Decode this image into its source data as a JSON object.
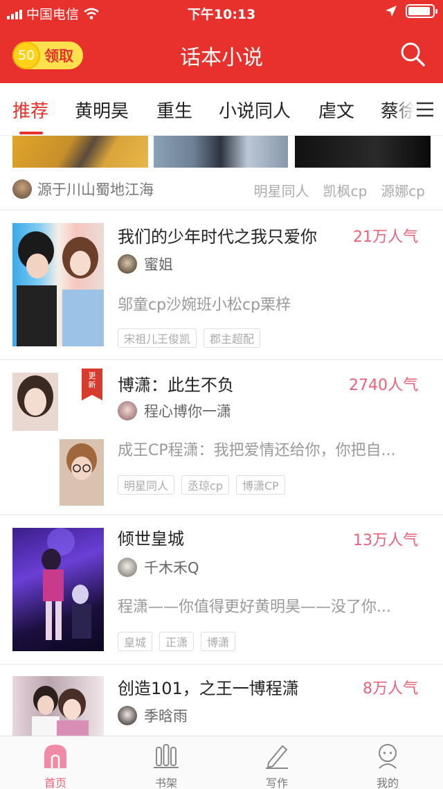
{
  "status_bar": {
    "carrier": "中国电信",
    "time": "下午10:13"
  },
  "header": {
    "claim_amount": "50",
    "claim_label": "领取",
    "title": "话本小说"
  },
  "tabs": [
    {
      "label": "推荐",
      "active": true
    },
    {
      "label": "黄明昊"
    },
    {
      "label": "重生"
    },
    {
      "label": "小说同人"
    },
    {
      "label": "虐文"
    },
    {
      "label": "蔡徐"
    }
  ],
  "top_strip": {
    "source": "源于川山蜀地江海",
    "tags": [
      "明星同人",
      "凯枫cp",
      "源娜cp"
    ]
  },
  "stories": [
    {
      "title": "我们的少年时代之我只爱你",
      "popularity": "21万人气",
      "author": "蜜姐",
      "description": "邬童cp沙婉班小松cp栗梓",
      "tags": [
        "宋祖儿王俊凯",
        "郡主超配"
      ],
      "updated": false
    },
    {
      "title": "博潇：此生不负",
      "popularity": "2740人气",
      "author": "程心博你一潇",
      "description": "成王CP程潇：我把爱情还给你，你把自...",
      "tags": [
        "明星同人",
        "丞琼cp",
        "博潇CP"
      ],
      "updated": true,
      "badge": "更新",
      "cover_caption": "博潇：此生不负"
    },
    {
      "title": "倾世皇城",
      "popularity": "13万人气",
      "author": "千木禾Q",
      "description": "程潇——你值得更好黄明昊——没了你...",
      "tags": [
        "皇城",
        "正潇",
        "博潇"
      ],
      "updated": false
    },
    {
      "title": "创造101，之王一博程潇",
      "popularity": "8万人气",
      "author": "季晗雨",
      "description": "",
      "tags": [],
      "updated": false
    }
  ],
  "bottom_nav": [
    {
      "label": "首页",
      "icon": "home-icon",
      "active": true
    },
    {
      "label": "书架",
      "icon": "bookshelf-icon"
    },
    {
      "label": "写作",
      "icon": "pen-icon"
    },
    {
      "label": "我的",
      "icon": "profile-icon"
    }
  ],
  "colors": {
    "brand": "#e8312c",
    "popularity": "#e8637a",
    "claim_bg": "#ffe14d"
  }
}
